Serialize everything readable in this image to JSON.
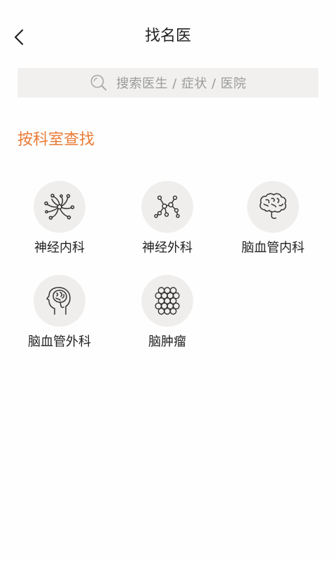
{
  "header": {
    "title": "找名医",
    "back_icon": "chevron-left-icon"
  },
  "search": {
    "placeholder": "搜索医生 / 症状 / 医院",
    "icon": "search-icon"
  },
  "section": {
    "title": "按科室查找",
    "accent_color": "#ea7b36"
  },
  "departments": [
    {
      "label": "神经内科",
      "icon": "neuron-icon"
    },
    {
      "label": "神经外科",
      "icon": "network-nodes-icon"
    },
    {
      "label": "脑血管内科",
      "icon": "brain-icon"
    },
    {
      "label": "脑血管外科",
      "icon": "head-brain-icon"
    },
    {
      "label": "脑肿瘤",
      "icon": "hexagon-cluster-icon"
    }
  ]
}
